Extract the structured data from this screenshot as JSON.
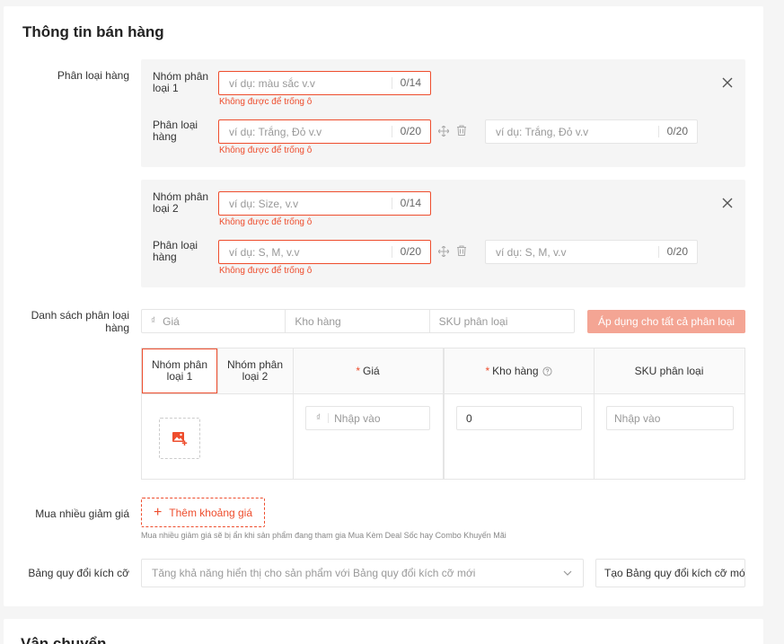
{
  "section_title": "Thông tin bán hàng",
  "variations": {
    "label": "Phân loại hàng",
    "groups": [
      {
        "name_label": "Nhóm phân loại 1",
        "name_placeholder": "ví dụ: màu sắc v.v",
        "name_count": "0/14",
        "name_error": "Không được để trống ô",
        "option_label": "Phân loại hàng",
        "option_placeholder": "ví dụ: Trắng, Đỏ v.v",
        "option_count": "0/20",
        "option_error": "Không được để trống ô",
        "option2_placeholder": "ví dụ: Trắng, Đỏ v.v",
        "option2_count": "0/20"
      },
      {
        "name_label": "Nhóm phân loại 2",
        "name_placeholder": "ví dụ: Size, v.v",
        "name_count": "0/14",
        "name_error": "Không được để trống ô",
        "option_label": "Phân loại hàng",
        "option_placeholder": "ví dụ: S, M, v.v",
        "option_count": "0/20",
        "option_error": "Không được để trống ô",
        "option2_placeholder": "ví dụ: S, M, v.v",
        "option2_count": "0/20"
      }
    ]
  },
  "variation_list": {
    "label": "Danh sách phân loại hàng",
    "currency_symbol": "₫",
    "price_placeholder": "Giá",
    "stock_placeholder": "Kho hàng",
    "sku_placeholder": "SKU phân loại",
    "apply_label": "Áp dụng cho tất cả phân loại"
  },
  "table": {
    "headers": {
      "group1": "Nhóm phân loại 1",
      "group2": "Nhóm phân loại 2",
      "price": "Giá",
      "stock": "Kho hàng",
      "sku": "SKU phân loại"
    },
    "required_mark": "*",
    "row": {
      "currency_symbol": "₫",
      "price_placeholder": "Nhập vào",
      "stock_value": "0",
      "sku_placeholder": "Nhập vào"
    }
  },
  "wholesale": {
    "label": "Mua nhiều giảm giá",
    "add_label": "Thêm khoảng giá",
    "note": "Mua nhiều giảm giá sẽ bị ẩn khi sản phẩm đang tham gia Mua Kèm Deal Sốc hay Combo Khuyến Mãi"
  },
  "size_chart": {
    "label": "Bảng quy đổi kích cỡ",
    "placeholder": "Tăng khả năng hiển thị cho sản phẩm với Bảng quy đổi kích cỡ mới",
    "create_label": "Tạo Bảng quy đổi kích cỡ mới"
  },
  "next_section_title": "Vận chuyển",
  "colors": {
    "accent": "#ee4d2d",
    "apply_button_disabled": "#f4a594"
  }
}
